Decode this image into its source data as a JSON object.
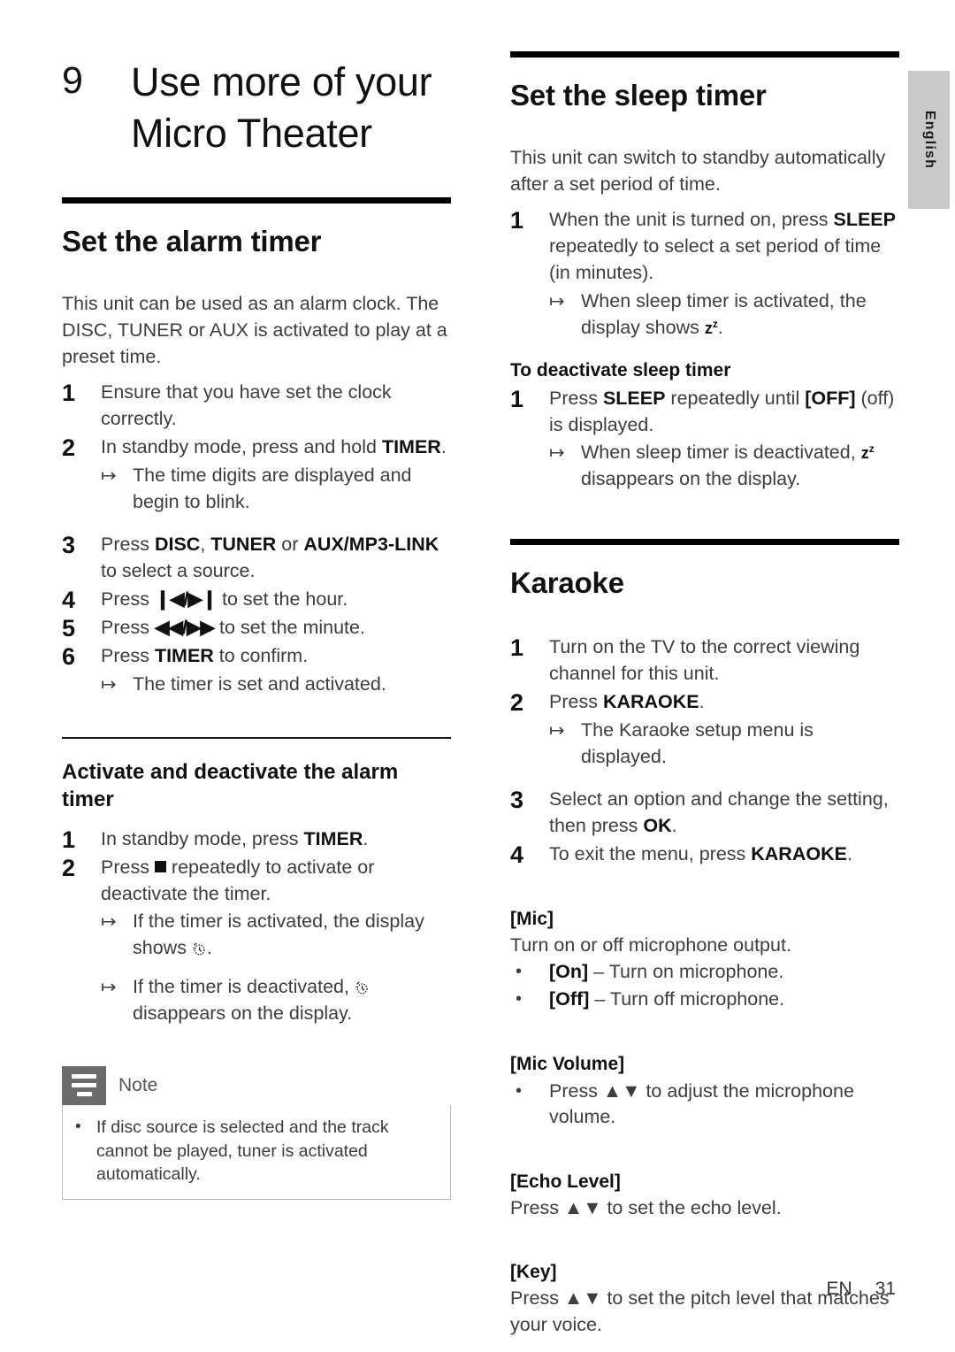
{
  "page": {
    "language_tab": "English",
    "footer_locale": "EN",
    "footer_page": "31"
  },
  "chapter": {
    "number": "9",
    "title": "Use more of your Micro Theater"
  },
  "left_column": {
    "alarm": {
      "heading": "Set the alarm timer",
      "intro": "This unit can be used as an alarm clock. The DISC, TUNER or AUX is activated to play at a preset time.",
      "steps": [
        {
          "num": "1",
          "text_before": "Ensure that you have set the clock correctly.",
          "bold": "",
          "text_after": ""
        },
        {
          "num": "2",
          "text_before": "In standby mode, press and hold ",
          "bold": "TIMER",
          "text_after": "."
        }
      ],
      "step2_result": "The time digits are displayed and begin to blink.",
      "step3": {
        "num": "3",
        "p1": "Press ",
        "b1": "DISC",
        "p2": ", ",
        "b2": "TUNER",
        "p3": " or ",
        "b3": "AUX/MP3-LINK",
        "p4": " to select a source."
      },
      "step4": {
        "num": "4",
        "p1": "Press ",
        "glyph": "❙◀/▶❙",
        "p2": " to set the hour."
      },
      "step5": {
        "num": "5",
        "p1": "Press ",
        "glyph": "◀◀/▶▶",
        "p2": " to set the minute."
      },
      "step6": {
        "num": "6",
        "p1": "Press ",
        "bold": "TIMER",
        "p2": " to confirm."
      },
      "step6_result": "The timer is set and activated."
    },
    "activate": {
      "heading": "Activate and deactivate the alarm timer",
      "step1": {
        "num": "1",
        "p1": "In standby mode, press ",
        "bold": "TIMER",
        "p2": "."
      },
      "step2": {
        "num": "2",
        "p1": "Press ",
        "glyph": "stop-square",
        "p2": " repeatedly to activate or deactivate the timer."
      },
      "result1_before": "If the timer is activated, the display shows ",
      "result1_icon": "alarm-clock-icon",
      "result1_after": ".",
      "result2_before": "If the timer is deactivated, ",
      "result2_icon": "alarm-clock-icon",
      "result2_after": " disappears on the display."
    },
    "note": {
      "label": "Note",
      "items": [
        "If disc source is selected and the track cannot be played, tuner is activated automatically."
      ]
    }
  },
  "right_column": {
    "sleep": {
      "heading": "Set the sleep timer",
      "intro": "This unit can switch to standby automatically after a set period of time.",
      "step1": {
        "num": "1",
        "p1": "When the unit is turned on, press ",
        "bold": "SLEEP",
        "p2": " repeatedly to select a set period of time (in minutes)."
      },
      "step1_result_before": "When sleep timer is activated, the display shows ",
      "sleep_icon": "z-superscript-z",
      "step1_result_after": ".",
      "deactivate_heading": "To deactivate sleep timer",
      "deactivate_step": {
        "num": "1",
        "p1": "Press ",
        "b1": "SLEEP",
        "p2": " repeatedly until ",
        "b2": "[OFF]",
        "p3": " (off) is displayed."
      },
      "deactivate_result_before": "When sleep timer is deactivated, ",
      "deactivate_result_after": " disappears on the display."
    },
    "karaoke": {
      "heading": "Karaoke",
      "step1": {
        "num": "1",
        "text": "Turn on the TV to the correct viewing channel for this unit."
      },
      "step2": {
        "num": "2",
        "p1": "Press ",
        "bold": "KARAOKE",
        "p2": "."
      },
      "step2_result": "The Karaoke setup menu is displayed.",
      "step3": {
        "num": "3",
        "p1": "Select an option and change the setting, then press ",
        "bold": "OK",
        "p2": "."
      },
      "step4": {
        "num": "4",
        "p1": "To exit the menu, press ",
        "bold": "KARAOKE",
        "p2": "."
      },
      "options": [
        {
          "title": "[Mic]",
          "desc": "Turn on or off microphone output.",
          "bullets": [
            {
              "bold": "[On]",
              "text": " – Turn on microphone."
            },
            {
              "bold": "[Off]",
              "text": " – Turn off microphone."
            }
          ]
        },
        {
          "title": "[Mic Volume]",
          "desc": "",
          "bullets": [
            {
              "bold": "",
              "text": "Press ▲▼ to adjust the microphone volume."
            }
          ]
        },
        {
          "title": "[Echo Level]",
          "desc": "Press ▲▼ to set the echo level.",
          "bullets": []
        },
        {
          "title": "[Key]",
          "desc": "Press ▲▼ to set the pitch level that matches your voice.",
          "bullets": []
        }
      ]
    }
  }
}
